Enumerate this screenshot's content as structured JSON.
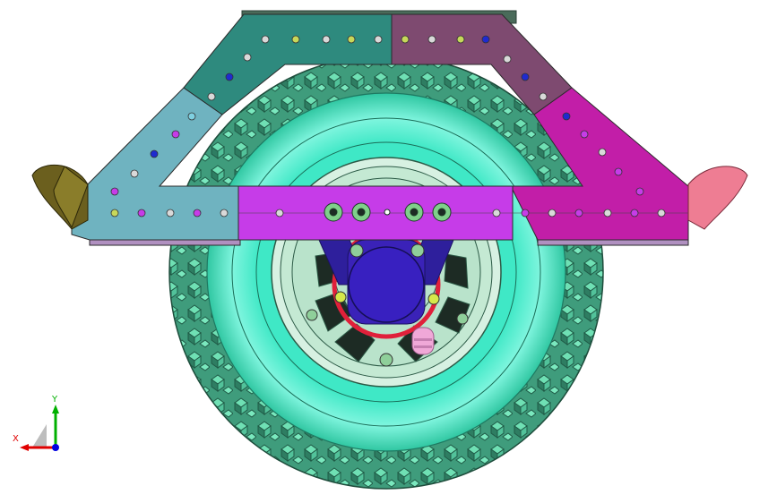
{
  "viewport": {
    "background": "#ffffff"
  },
  "model": {
    "tire_color": "#5fd7a6",
    "tire_dark": "#2f9e78",
    "tire_inner": "#46f0c8",
    "rim_color": "#cfeedd",
    "hub_color": "#2e1f9c",
    "ring_color": "#e0203a",
    "plate_cyan": "#6fb3c0",
    "plate_teal": "#2e8a7e",
    "plate_mauve": "#7e4a70",
    "plate_magenta": "#c21ea8",
    "bar_purple": "#c63ce8",
    "bumper_left": "#6b5f1e",
    "bumper_right": "#ee7d93",
    "valve_color": "#f0a8d8"
  },
  "triad": {
    "x_label": "X",
    "y_label": "Y",
    "x_color": "#e00000",
    "y_color": "#00b000",
    "z_color": "#0000e0"
  }
}
